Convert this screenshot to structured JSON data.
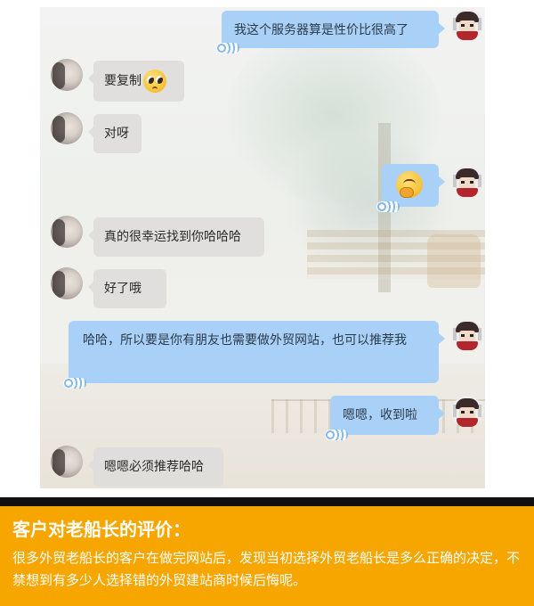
{
  "chat": {
    "messages": [
      {
        "sender": "captain",
        "text": "我这个服务器算是性价比很高了"
      },
      {
        "sender": "customer",
        "text": "要复制",
        "emoji": "pleading-face-emoji"
      },
      {
        "sender": "customer",
        "text": "对呀"
      },
      {
        "sender": "captain",
        "text": "",
        "emoji": "thinking-face-emoji"
      },
      {
        "sender": "customer",
        "text": "真的很幸运找到你哈哈哈"
      },
      {
        "sender": "customer",
        "text": "好了哦"
      },
      {
        "sender": "captain",
        "text": "哈哈，所以要是你有朋友也需要做外贸网站，也可以推荐我"
      },
      {
        "sender": "captain",
        "text": "嗯嗯，收到啦"
      },
      {
        "sender": "customer",
        "text": "嗯嗯必须推荐哈哈"
      }
    ]
  },
  "footer": {
    "title": "客户对老船长的评价：",
    "body": "很多外贸老船长的客户在做完网站后，发现当初选择外贸老船长是多么正确的决定，不禁想到有多少人选择错的外贸建站商时候后悔呢。"
  },
  "colors": {
    "outgoing_bubble": "#a9d1f8",
    "incoming_bubble": "#dedddb",
    "footer_background": "#f7a600",
    "footer_text": "#ffffff"
  }
}
